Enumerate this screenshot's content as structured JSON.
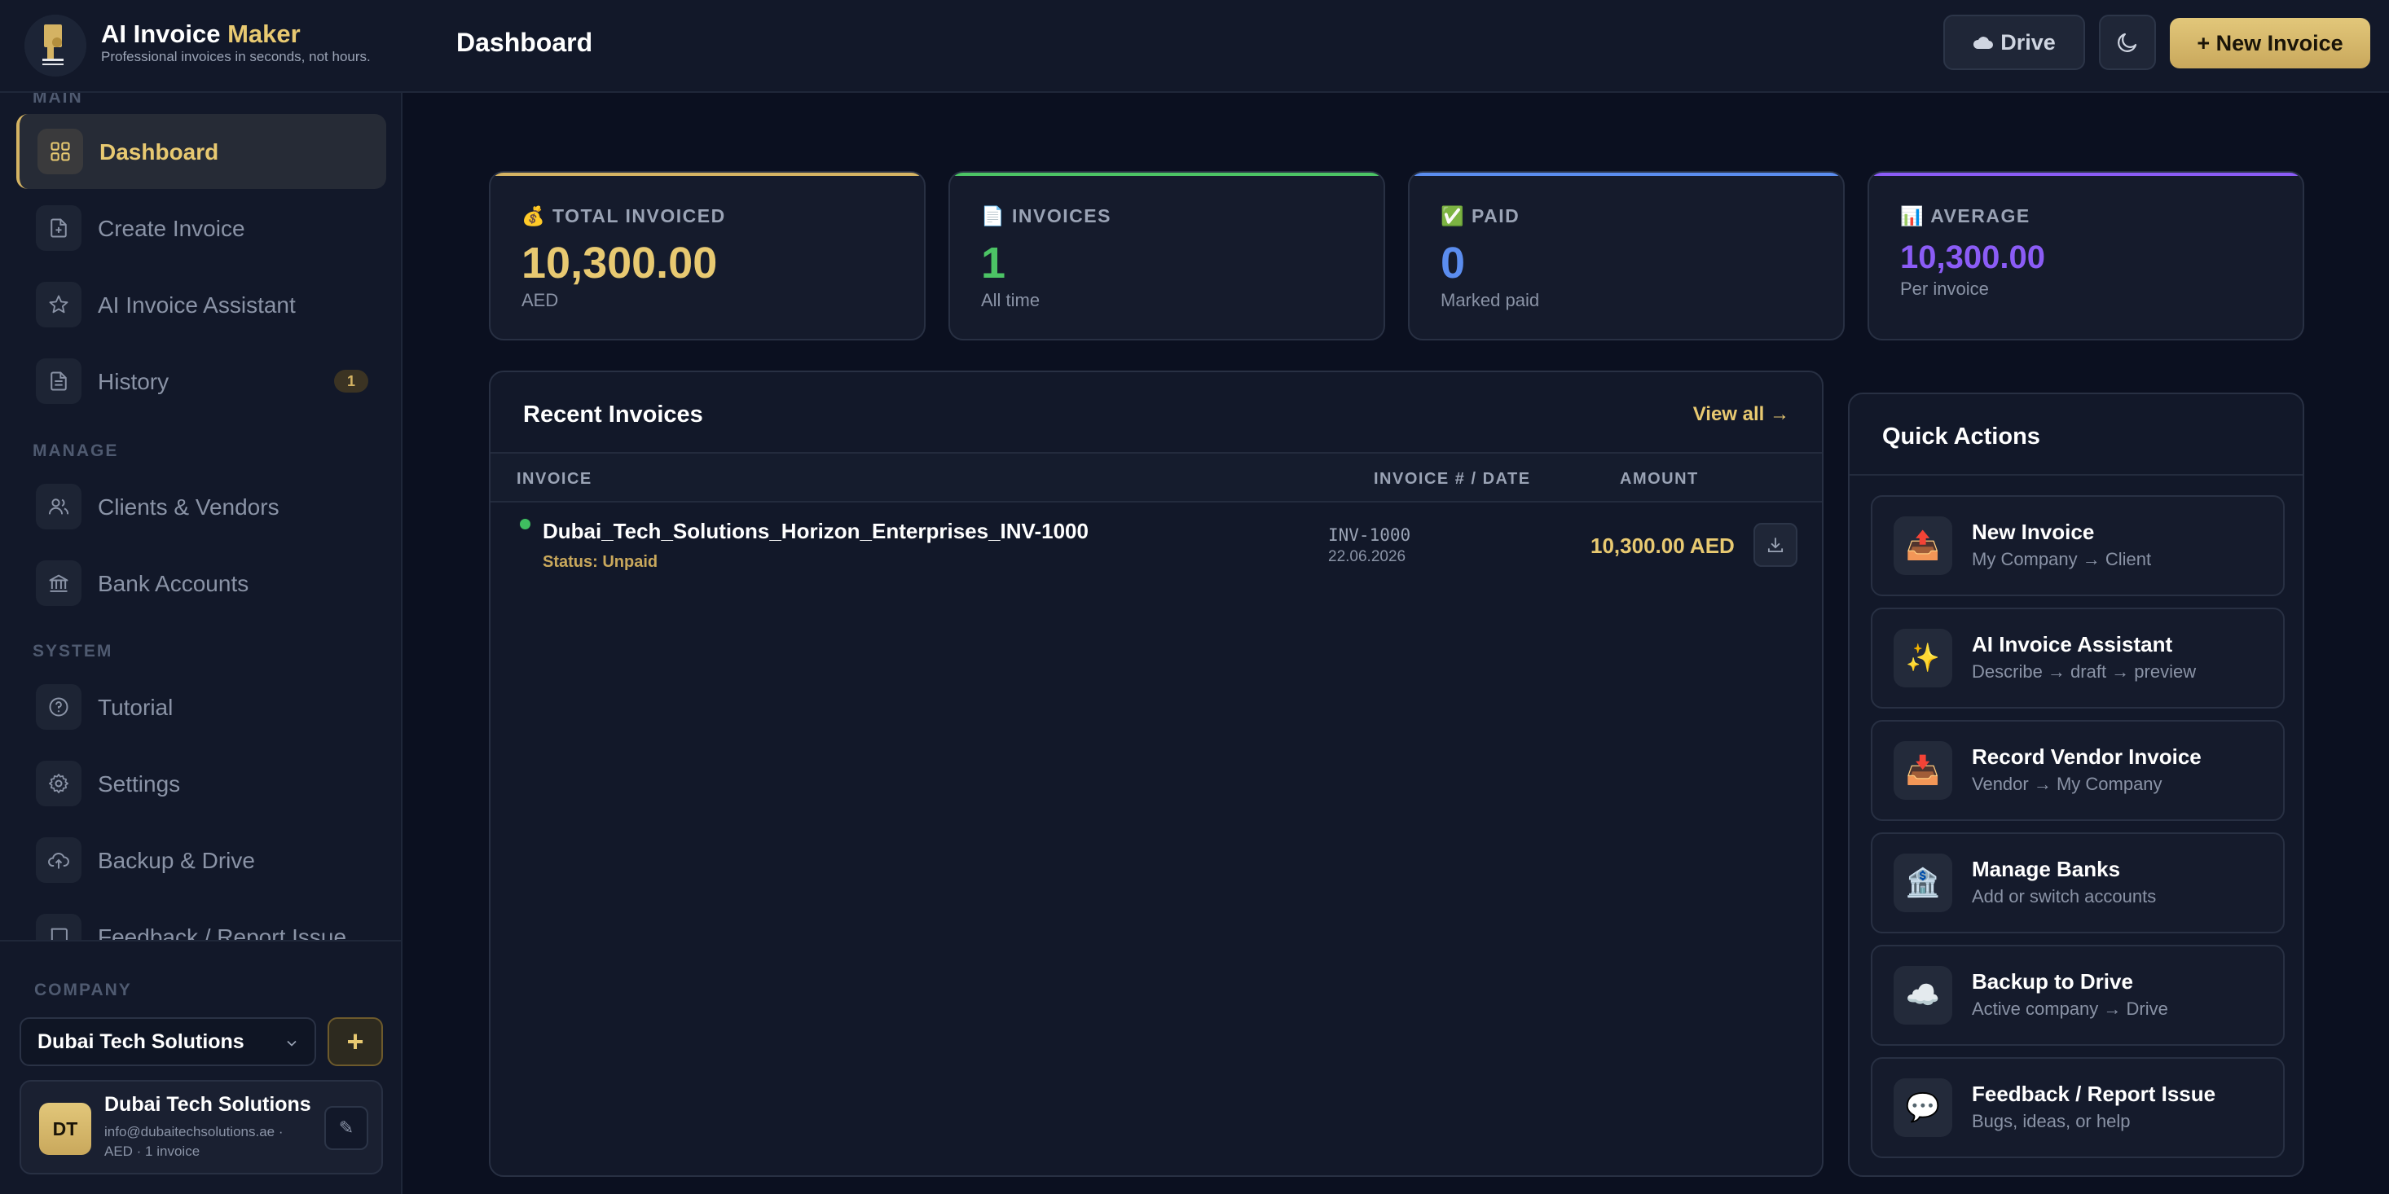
{
  "header": {
    "app_title_main": "AI Invoice",
    "app_title_accent": "Maker",
    "tagline": "Professional invoices in seconds, not hours.",
    "page_title": "Dashboard",
    "drive_label": "Drive",
    "new_invoice_label": "+ New Invoice"
  },
  "sidebar": {
    "sections": {
      "main": "MAIN",
      "manage": "MANAGE",
      "system": "SYSTEM",
      "company": "COMPANY"
    },
    "items": [
      {
        "label": "Dashboard",
        "icon": "grid-icon",
        "active": true
      },
      {
        "label": "Create Invoice",
        "icon": "file-plus-icon"
      },
      {
        "label": "AI Invoice Assistant",
        "icon": "star-icon"
      },
      {
        "label": "History",
        "icon": "document-icon",
        "badge": "1"
      },
      {
        "label": "Clients & Vendors",
        "icon": "users-icon"
      },
      {
        "label": "Bank Accounts",
        "icon": "bank-icon"
      },
      {
        "label": "Tutorial",
        "icon": "help-circle-icon"
      },
      {
        "label": "Settings",
        "icon": "gear-icon"
      },
      {
        "label": "Backup & Drive",
        "icon": "cloud-upload-icon"
      },
      {
        "label": "Feedback / Report Issue",
        "icon": "message-icon"
      }
    ],
    "company": {
      "selected": "Dubai Tech Solutions",
      "add_label": "+",
      "avatar_initials": "DT",
      "name": "Dubai Tech Solutions",
      "email_line": "info@dubaitechsolutions.ae ·",
      "meta_line": "AED · 1 invoice",
      "edit_icon": "✎"
    }
  },
  "stats": [
    {
      "emoji": "💰",
      "label": "TOTAL INVOICED",
      "value": "10,300.00",
      "sub": "AED",
      "color": "#e8c971"
    },
    {
      "emoji": "📄",
      "label": "INVOICES",
      "value": "1",
      "sub": "All time",
      "color": "#4cc465"
    },
    {
      "emoji": "✅",
      "label": "PAID",
      "value": "0",
      "sub": "Marked paid",
      "color": "#5b8def"
    },
    {
      "emoji": "📊",
      "label": "AVERAGE",
      "value": "10,300.00",
      "sub": "Per invoice",
      "color": "#8b5cf6"
    }
  ],
  "recent": {
    "title": "Recent Invoices",
    "view_all": "View all →",
    "columns": [
      "INVOICE",
      "INVOICE # / DATE",
      "AMOUNT"
    ],
    "rows": [
      {
        "name": "Dubai_Tech_Solutions_Horizon_Enterprises_INV-1000",
        "status": "Status: Unpaid",
        "number": "INV-1000",
        "date": "22.06.2026",
        "amount": "10,300.00 AED"
      }
    ]
  },
  "quick_actions": {
    "title": "Quick Actions",
    "items": [
      {
        "emoji": "📤",
        "title": "New Invoice",
        "sub": "My Company → Client"
      },
      {
        "emoji": "✨",
        "title": "AI Invoice Assistant",
        "sub": "Describe → draft → preview"
      },
      {
        "emoji": "📥",
        "title": "Record Vendor Invoice",
        "sub": "Vendor → My Company"
      },
      {
        "emoji": "🏦",
        "title": "Manage Banks",
        "sub": "Add or switch accounts"
      },
      {
        "emoji": "☁️",
        "title": "Backup to Drive",
        "sub": "Active company → Drive"
      },
      {
        "emoji": "💬",
        "title": "Feedback / Report Issue",
        "sub": "Bugs, ideas, or help"
      }
    ]
  },
  "colors": {
    "accent_gold": "#e8c971",
    "green": "#4cc465",
    "blue": "#5b8def",
    "purple": "#8b5cf6",
    "background": "#0b1020",
    "panel": "#121829"
  }
}
